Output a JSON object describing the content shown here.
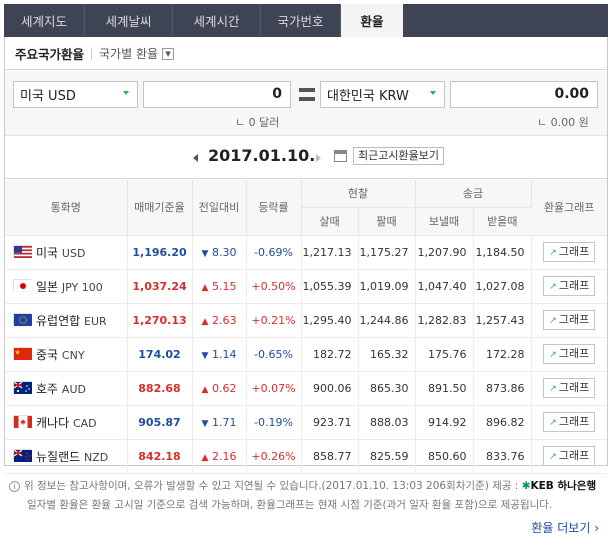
{
  "tabs": [
    "세계지도",
    "세계날씨",
    "세계시간",
    "국가번호",
    "환율"
  ],
  "subheader": {
    "title": "주요국가환율",
    "link": "국가별 환율"
  },
  "calculator": {
    "from_currency": "미국 USD",
    "from_amount": "0",
    "from_sub": "ㄴ 0 달러",
    "to_currency": "대한민국 KRW",
    "to_amount": "0.00",
    "to_sub": "ㄴ 0.00 원"
  },
  "date_bar": {
    "date": "2017.01.10.",
    "recent_button": "최근고시환율보기"
  },
  "table": {
    "headers": {
      "currency": "통화명",
      "base": "매매기준율",
      "change": "전일대비",
      "rate": "등락률",
      "cash": "현찰",
      "cash_buy": "살때",
      "cash_sell": "팔때",
      "remit": "송금",
      "remit_send": "보낼때",
      "remit_recv": "받을때",
      "graph": "환율그래프"
    },
    "graph_label": "그래프",
    "rows": [
      {
        "country": "미국",
        "code": "USD",
        "flag": "us-flag",
        "base": "1,196.20",
        "dir": "down",
        "change": "8.30",
        "rate": "-0.69%",
        "cash_buy": "1,217.13",
        "cash_sell": "1,175.27",
        "send": "1,207.90",
        "recv": "1,184.50"
      },
      {
        "country": "일본",
        "code": "JPY 100",
        "flag": "jp-flag",
        "base": "1,037.24",
        "dir": "up",
        "change": "5.15",
        "rate": "+0.50%",
        "cash_buy": "1,055.39",
        "cash_sell": "1,019.09",
        "send": "1,047.40",
        "recv": "1,027.08"
      },
      {
        "country": "유럽연합",
        "code": "EUR",
        "flag": "eu-flag",
        "base": "1,270.13",
        "dir": "up",
        "change": "2.63",
        "rate": "+0.21%",
        "cash_buy": "1,295.40",
        "cash_sell": "1,244.86",
        "send": "1,282.83",
        "recv": "1,257.43"
      },
      {
        "country": "중국",
        "code": "CNY",
        "flag": "cn-flag",
        "base": "174.02",
        "dir": "down",
        "change": "1.14",
        "rate": "-0.65%",
        "cash_buy": "182.72",
        "cash_sell": "165.32",
        "send": "175.76",
        "recv": "172.28"
      },
      {
        "country": "호주",
        "code": "AUD",
        "flag": "au-flag",
        "base": "882.68",
        "dir": "up",
        "change": "0.62",
        "rate": "+0.07%",
        "cash_buy": "900.06",
        "cash_sell": "865.30",
        "send": "891.50",
        "recv": "873.86"
      },
      {
        "country": "캐나다",
        "code": "CAD",
        "flag": "ca-flag",
        "base": "905.87",
        "dir": "down",
        "change": "1.71",
        "rate": "-0.19%",
        "cash_buy": "923.71",
        "cash_sell": "888.03",
        "send": "914.92",
        "recv": "896.82"
      },
      {
        "country": "뉴질랜드",
        "code": "NZD",
        "flag": "nz-flag",
        "base": "842.18",
        "dir": "up",
        "change": "2.16",
        "rate": "+0.26%",
        "cash_buy": "858.77",
        "cash_sell": "825.59",
        "send": "850.60",
        "recv": "833.76"
      }
    ]
  },
  "footer": {
    "notice1": "위 정보는 참고사항이며, 오류가 발생할 수 있고 지연될 수 있습니다.(2017.01.10. 13:03 206회차기준)  제공 :",
    "provider": "KEB 하나은행",
    "notice2": "일자별 환율은 환율 고시일 기준으로 검색 가능하며, 환율그래프는 현재 시점 기준(과거 일자 환율 포함)으로 제공됩니다.",
    "more": "환율 더보기"
  }
}
